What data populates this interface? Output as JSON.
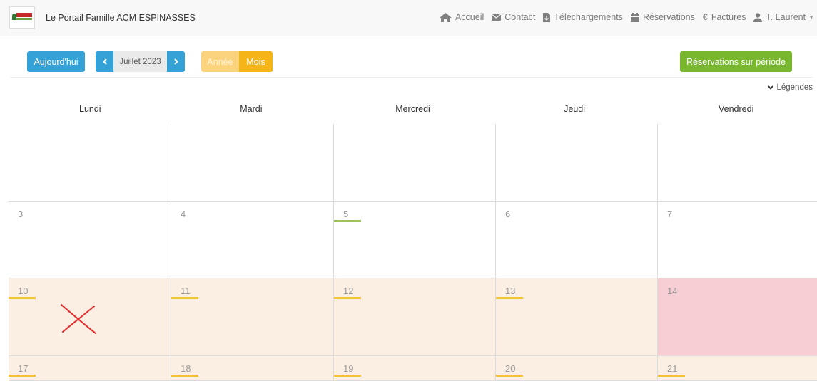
{
  "header": {
    "brand": "Le Portail Famille ACM ESPINASSES",
    "nav": [
      {
        "label": "Accueil",
        "icon": "home-icon"
      },
      {
        "label": "Contact",
        "icon": "envelope-icon"
      },
      {
        "label": "Téléchargements",
        "icon": "file-download-icon"
      },
      {
        "label": "Réservations",
        "icon": "calendar-icon"
      },
      {
        "label": "Factures",
        "icon": "euro-icon"
      },
      {
        "label": "T. Laurent",
        "icon": "user-icon"
      }
    ]
  },
  "toolbar": {
    "today_label": "Aujourd'hui",
    "month_label": "Juillet 2023",
    "year_view_label": "Année",
    "month_view_label": "Mois",
    "period_label": "Réservations sur période",
    "legend_label": "Légendes"
  },
  "calendar": {
    "weekdays": [
      "Lundi",
      "Mardi",
      "Mercredi",
      "Jeudi",
      "Vendredi"
    ],
    "weeks": [
      [
        {
          "day": "",
          "bg": "#ffffff",
          "bar": ""
        },
        {
          "day": "",
          "bg": "#ffffff",
          "bar": ""
        },
        {
          "day": "",
          "bg": "#ffffff",
          "bar": ""
        },
        {
          "day": "",
          "bg": "#ffffff",
          "bar": ""
        },
        {
          "day": "",
          "bg": "#ffffff",
          "bar": ""
        }
      ],
      [
        {
          "day": "3",
          "bg": "#ffffff",
          "bar": ""
        },
        {
          "day": "4",
          "bg": "#ffffff",
          "bar": ""
        },
        {
          "day": "5",
          "bg": "#ffffff",
          "bar": "#9fc35a"
        },
        {
          "day": "6",
          "bg": "#ffffff",
          "bar": ""
        },
        {
          "day": "7",
          "bg": "#ffffff",
          "bar": ""
        }
      ],
      [
        {
          "day": "10",
          "bg": "#fbeee3",
          "bar": "#f0c234"
        },
        {
          "day": "11",
          "bg": "#fbeee3",
          "bar": "#f0c234"
        },
        {
          "day": "12",
          "bg": "#fbeee3",
          "bar": "#f0c234"
        },
        {
          "day": "13",
          "bg": "#fbeee3",
          "bar": "#f0c234"
        },
        {
          "day": "14",
          "bg": "#f6ced3",
          "bar": ""
        }
      ],
      [
        {
          "day": "17",
          "bg": "#fbeee3",
          "bar": "#f0c234"
        },
        {
          "day": "18",
          "bg": "#fbeee3",
          "bar": "#f0c234"
        },
        {
          "day": "19",
          "bg": "#fbeee3",
          "bar": "#f0c234"
        },
        {
          "day": "20",
          "bg": "#fbeee3",
          "bar": "#f0c234"
        },
        {
          "day": "21",
          "bg": "#fbeee3",
          "bar": "#f0c234"
        }
      ]
    ]
  },
  "colors": {
    "primary": "#35a2d7",
    "warning": "#f5b418",
    "success": "#79b72f",
    "annotation": "#e02a2a"
  }
}
